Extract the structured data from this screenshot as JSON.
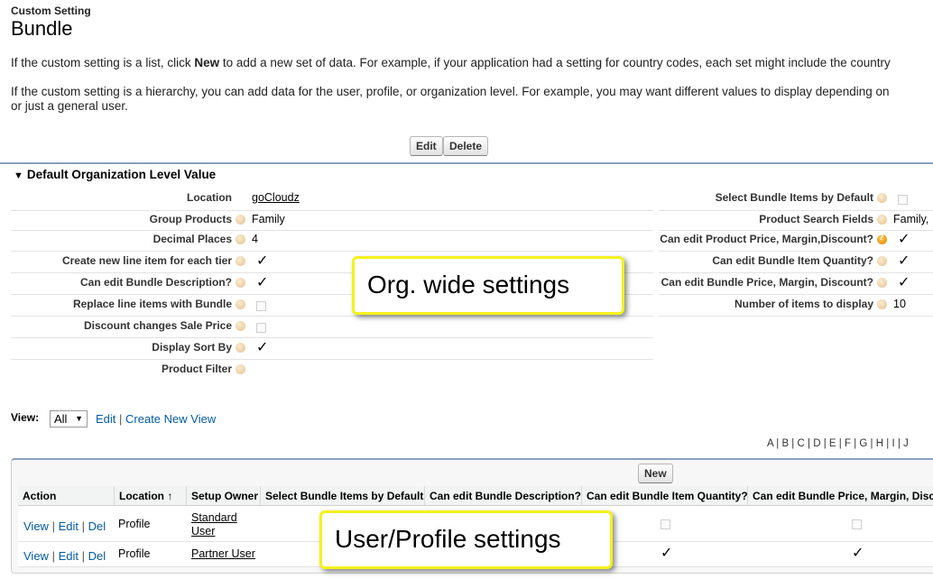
{
  "header": {
    "page_type": "Custom Setting",
    "title": "Bundle"
  },
  "intro": {
    "line1_a": "If the custom setting is a list, click ",
    "line1_b": "New",
    "line1_c": " to add a new set of data. For example, if your application had a setting for country codes, each set might include the country",
    "line2": "If the custom setting is a hierarchy, you can add data for the user, profile, or organization level. For example, you may want different values to display depending on",
    "line3": "or just a general user."
  },
  "buttons": {
    "edit": "Edit",
    "delete": "Delete",
    "new": "New"
  },
  "section": {
    "title": "Default Organization Level Value",
    "left_fields": [
      {
        "label": "Location",
        "value": "goCloudz"
      },
      {
        "label": "Group Products",
        "value": "Family"
      },
      {
        "label": "Decimal Places",
        "value": "4"
      },
      {
        "label": "Create new line item for each tier",
        "checked": true
      },
      {
        "label": "Can edit Bundle Description?",
        "checked": true
      },
      {
        "label": "Replace line items with Bundle",
        "checked": false
      },
      {
        "label": "Discount changes Sale Price",
        "checked": false
      },
      {
        "label": "Display Sort By",
        "checked": true
      },
      {
        "label": "Product Filter",
        "value": ""
      }
    ],
    "right_fields": [
      {
        "label": "Select Bundle Items by Default",
        "checked": false
      },
      {
        "label": "Product Search Fields",
        "value": "Family,"
      },
      {
        "label": "Can edit Product Price, Margin,Discount?",
        "checked": true
      },
      {
        "label": "Can edit Bundle Item Quantity?",
        "checked": true
      },
      {
        "label": "Can edit Bundle Price, Margin, Discount?",
        "checked": true
      },
      {
        "label": "Number of items to display",
        "value": "10"
      }
    ]
  },
  "callouts": {
    "org": "Org. wide settings",
    "user": "User/Profile settings"
  },
  "view": {
    "label": "View:",
    "selected": "All",
    "edit_link": "Edit",
    "create_link": "Create New View"
  },
  "alphabet": [
    "A",
    "B",
    "C",
    "D",
    "E",
    "F",
    "G",
    "H",
    "I",
    "J"
  ],
  "table": {
    "columns": [
      "Action",
      "Location ↑",
      "Setup Owner",
      "Select Bundle Items by Default",
      "Can edit Bundle Description?",
      "Can edit Bundle Item Quantity?",
      "Can edit Bundle Price, Margin, Discount?"
    ],
    "action_links": {
      "view": "View",
      "edit": "Edit",
      "del": "Del"
    },
    "rows": [
      {
        "location": "Profile",
        "owner_line1": "Standard",
        "owner_line2": "User",
        "qty_checked": false,
        "price_checked": false
      },
      {
        "location": "Profile",
        "owner_line1": "Partner User",
        "owner_line2": "",
        "qty_checked": true,
        "price_checked": true
      }
    ]
  },
  "colors": {
    "link": "#015ba7",
    "section_rule": "#8a9ebe",
    "callout_border": "#f4f21b",
    "help_active": "#e08000"
  }
}
